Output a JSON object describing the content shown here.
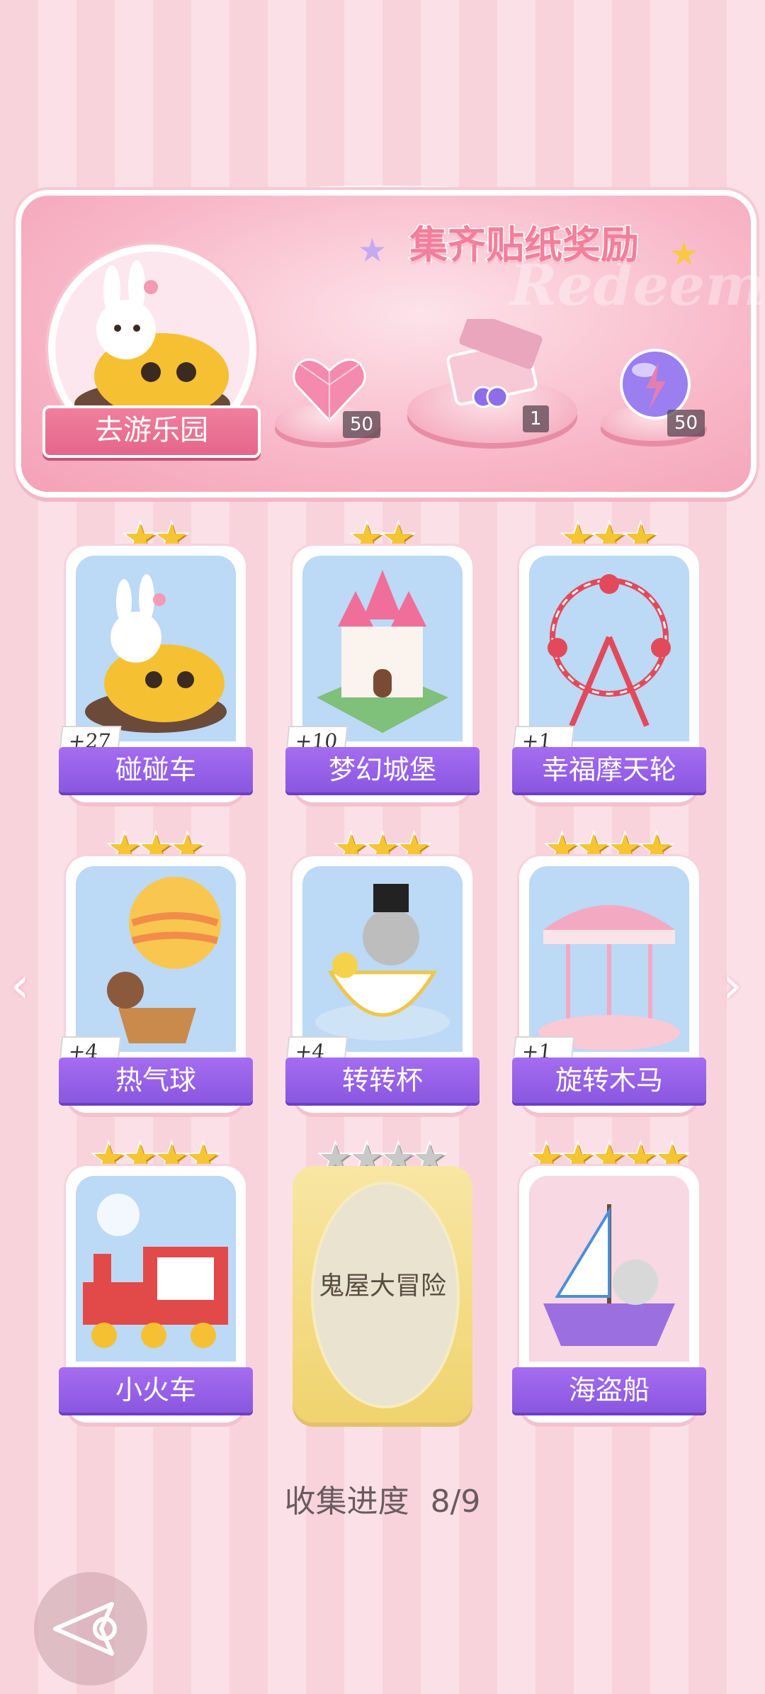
{
  "banner": {
    "title": "集齐贴纸奖励",
    "watermark": "Redeem",
    "go_button": "去游乐园",
    "rewards": [
      {
        "name": "heart-gem",
        "count": "50"
      },
      {
        "name": "sticker-gift-box",
        "count": "1"
      },
      {
        "name": "energy-orb",
        "count": "50"
      }
    ]
  },
  "cards": [
    {
      "name": "碰碰车",
      "count": "+27",
      "stars": 2,
      "locked": false
    },
    {
      "name": "梦幻城堡",
      "count": "+10",
      "stars": 2,
      "locked": false
    },
    {
      "name": "幸福摩天轮",
      "count": "+1",
      "stars": 3,
      "locked": false
    },
    {
      "name": "热气球",
      "count": "+4",
      "stars": 3,
      "locked": false
    },
    {
      "name": "转转杯",
      "count": "+4",
      "stars": 3,
      "locked": false
    },
    {
      "name": "旋转木马",
      "count": "+1",
      "stars": 4,
      "locked": false
    },
    {
      "name": "小火车",
      "count": "",
      "stars": 4,
      "locked": false
    },
    {
      "name": "鬼屋大冒险",
      "count": "",
      "stars": 4,
      "locked": true
    },
    {
      "name": "海盗船",
      "count": "",
      "stars": 5,
      "locked": false
    }
  ],
  "progress": {
    "label": "收集进度",
    "value": "8/9"
  },
  "nav": {
    "prev": "‹",
    "next": "›"
  },
  "colors": {
    "label_purple": "#8a57e0",
    "banner_pink": "#f8b7c8",
    "star_gold": "#f6c534"
  }
}
